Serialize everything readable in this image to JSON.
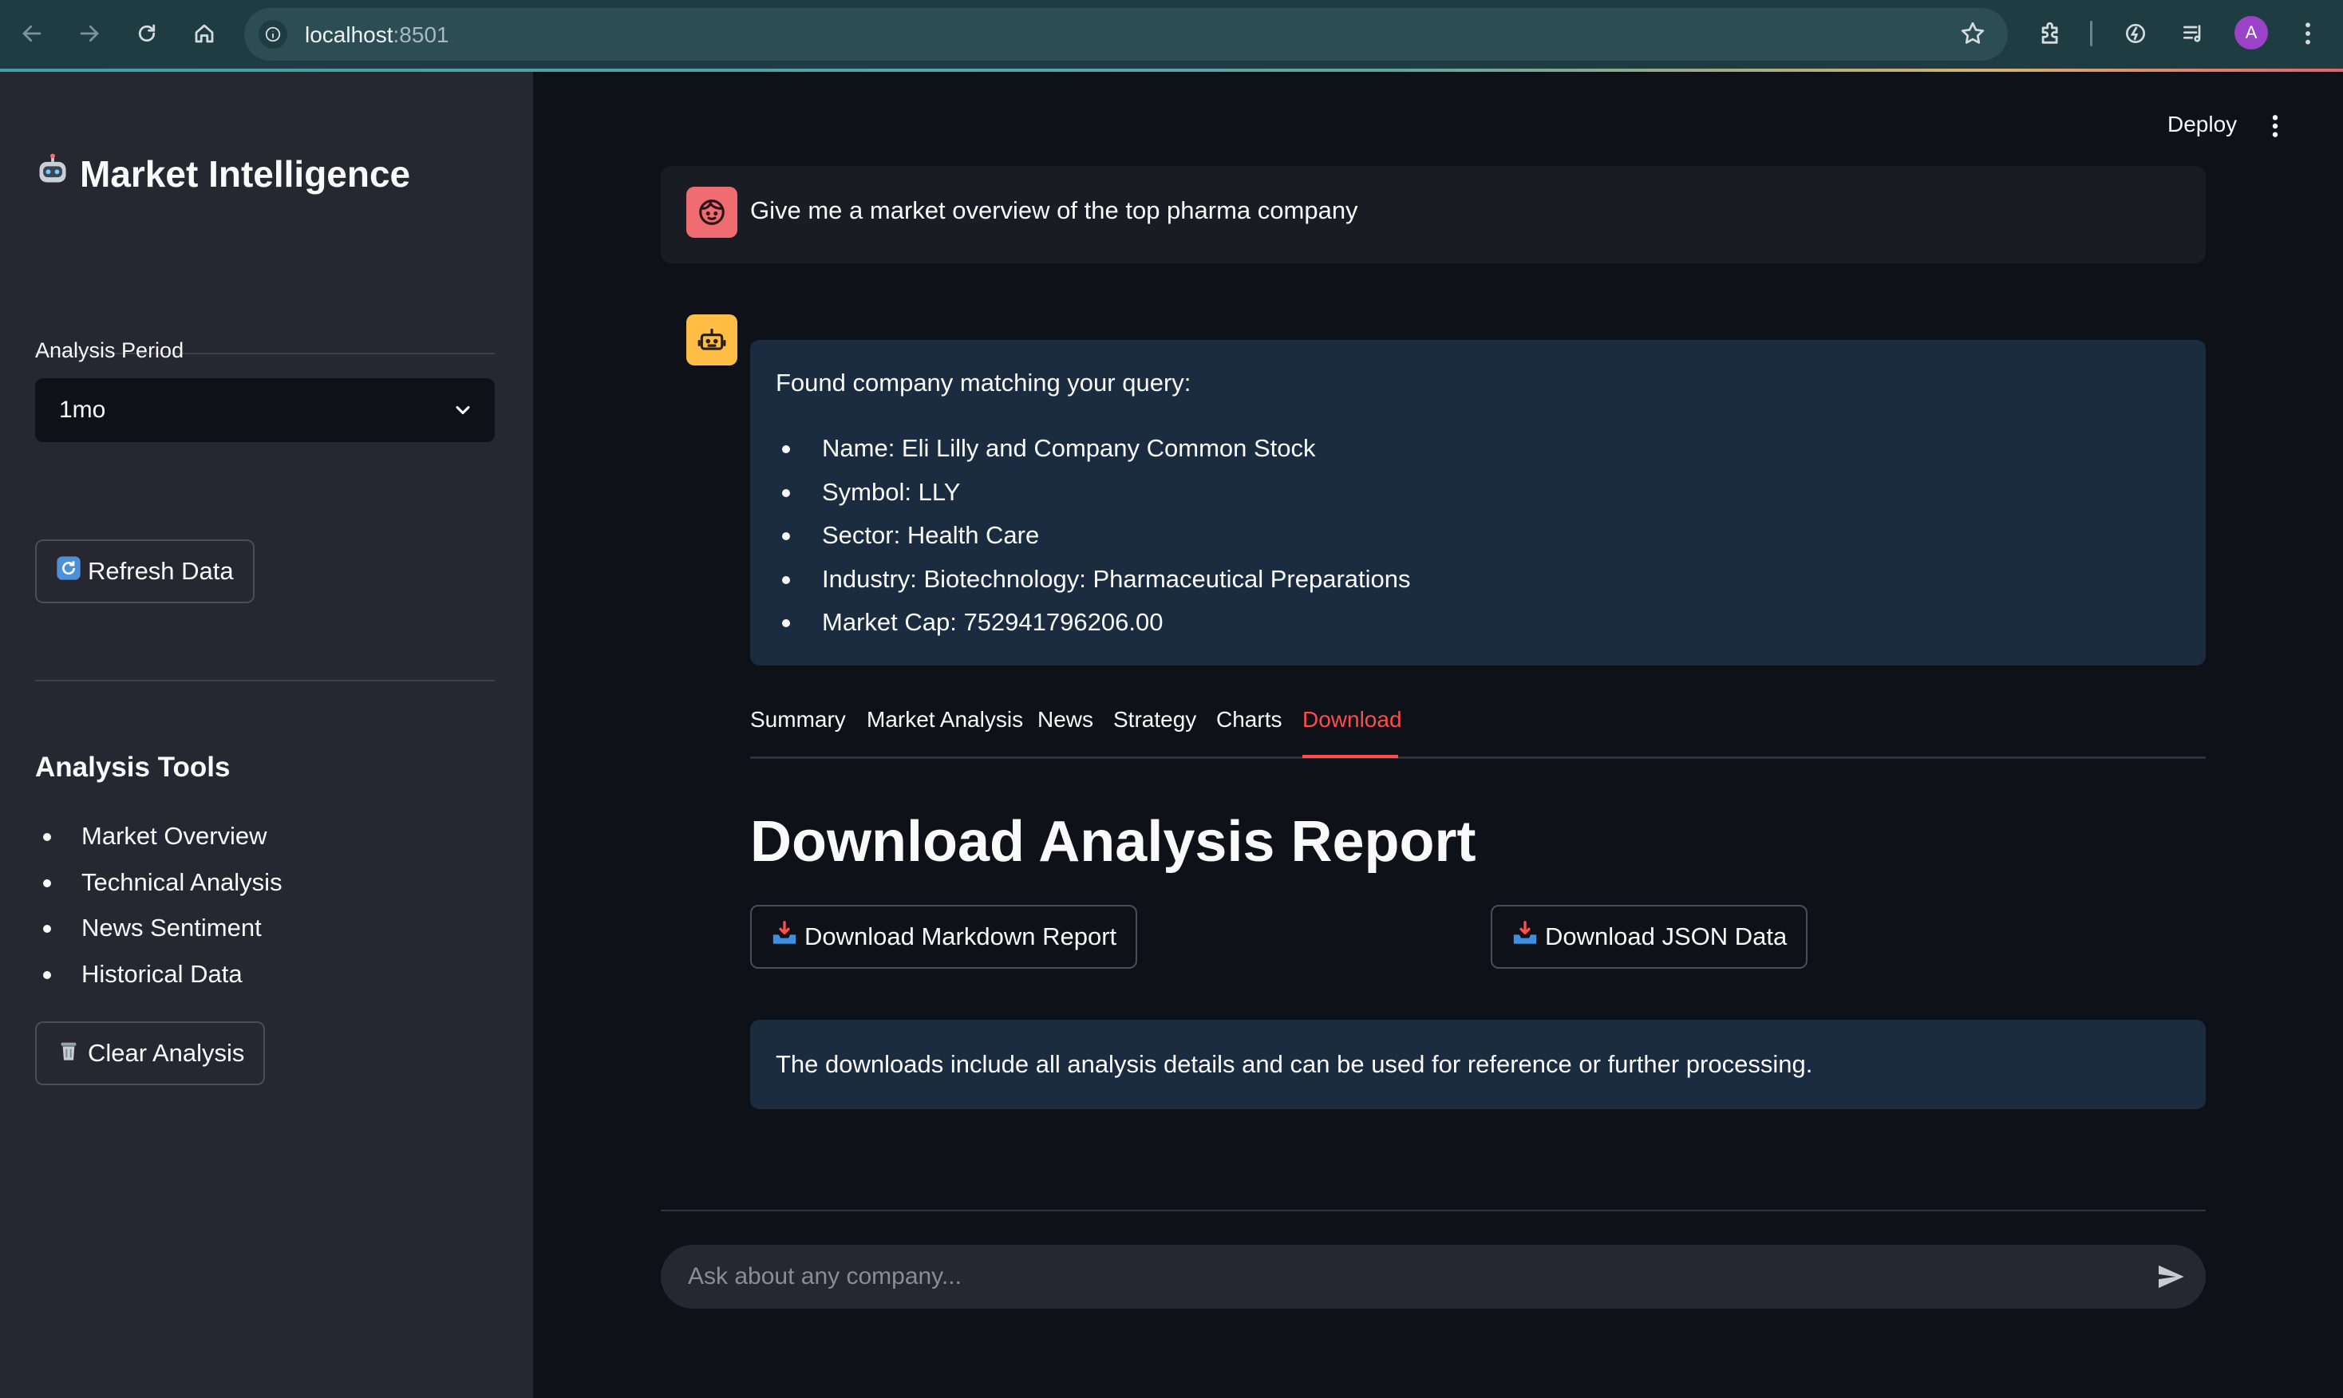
{
  "browser": {
    "url_host": "localhost",
    "url_port": ":8501",
    "avatar_letter": "A"
  },
  "sidebar": {
    "title_icon": "robot-emoji",
    "title": "Market Intelligence",
    "period_label": "Analysis Period",
    "period_value": "1mo",
    "refresh_button": "Refresh Data",
    "tools_heading": "Analysis Tools",
    "tools": [
      "Market Overview",
      "Technical Analysis",
      "News Sentiment",
      "Historical Data"
    ],
    "clear_button": "Clear Analysis"
  },
  "header": {
    "deploy_label": "Deploy"
  },
  "chat": {
    "user_message": "Give me a market overview of the top pharma company",
    "bot_intro": "Found company matching your query:",
    "bot_details": [
      "Name: Eli Lilly and Company Common Stock",
      "Symbol: LLY",
      "Sector: Health Care",
      "Industry: Biotechnology: Pharmaceutical Preparations",
      "Market Cap: 752941796206.00"
    ],
    "tabs": [
      "Summary",
      "Market Analysis",
      "News",
      "Strategy",
      "Charts",
      "Download"
    ],
    "active_tab": "Download",
    "download_heading": "Download Analysis Report",
    "download_markdown_button": "Download Markdown Report",
    "download_json_button": "Download JSON Data",
    "info_text": "The downloads include all analysis details and can be used for reference or further processing.",
    "input_placeholder": "Ask about any company..."
  },
  "colors": {
    "accent": "#ff4b4b",
    "user_avatar": "#f06c73",
    "bot_avatar": "#ffbd45",
    "sidebar_bg": "#262730",
    "main_bg": "#0e1117",
    "info_bg": "#1b2b40"
  }
}
